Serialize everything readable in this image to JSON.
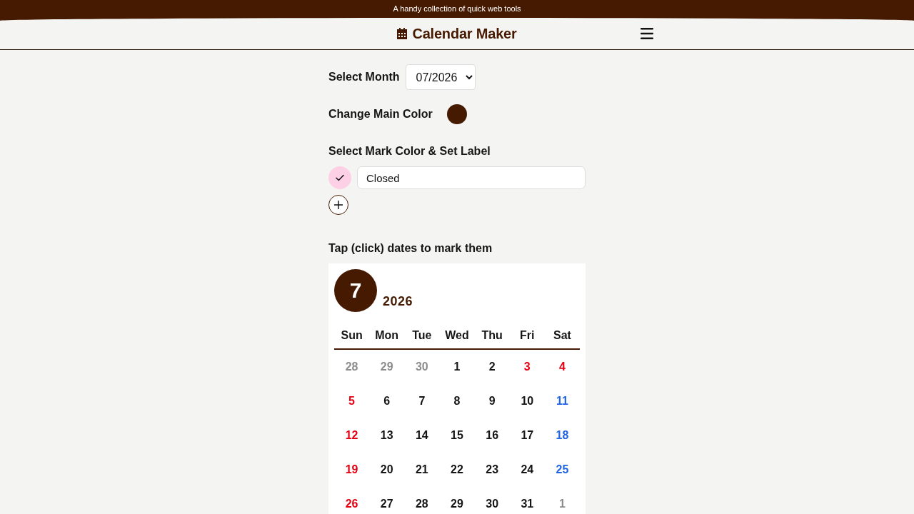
{
  "banner": {
    "text": "A handy collection of quick web tools"
  },
  "header": {
    "title": "Calendar Maker"
  },
  "month_select": {
    "label": "Select Month",
    "value": "07/2026"
  },
  "main_color": {
    "label": "Change Main Color",
    "color": "#461a00"
  },
  "marks_section": {
    "heading": "Select Mark Color & Set Label",
    "marks": [
      {
        "color": "#fdd0e6",
        "selected": true,
        "label": "Closed"
      }
    ]
  },
  "calendar": {
    "instruction": "Tap (click) dates to mark them",
    "month": "7",
    "year": "2026",
    "weekdays": [
      "Sun",
      "Mon",
      "Tue",
      "Wed",
      "Thu",
      "Fri",
      "Sat"
    ],
    "weeks": [
      [
        {
          "day": "28",
          "kind": "outside"
        },
        {
          "day": "29",
          "kind": "outside"
        },
        {
          "day": "30",
          "kind": "outside"
        },
        {
          "day": "1",
          "kind": "plain"
        },
        {
          "day": "2",
          "kind": "plain"
        },
        {
          "day": "3",
          "kind": "holiday"
        },
        {
          "day": "4",
          "kind": "holiday"
        }
      ],
      [
        {
          "day": "5",
          "kind": "holiday"
        },
        {
          "day": "6",
          "kind": "plain"
        },
        {
          "day": "7",
          "kind": "plain"
        },
        {
          "day": "8",
          "kind": "plain"
        },
        {
          "day": "9",
          "kind": "plain"
        },
        {
          "day": "10",
          "kind": "plain"
        },
        {
          "day": "11",
          "kind": "saturday"
        }
      ],
      [
        {
          "day": "12",
          "kind": "holiday"
        },
        {
          "day": "13",
          "kind": "plain"
        },
        {
          "day": "14",
          "kind": "plain"
        },
        {
          "day": "15",
          "kind": "plain"
        },
        {
          "day": "16",
          "kind": "plain"
        },
        {
          "day": "17",
          "kind": "plain"
        },
        {
          "day": "18",
          "kind": "saturday"
        }
      ],
      [
        {
          "day": "19",
          "kind": "holiday"
        },
        {
          "day": "20",
          "kind": "plain"
        },
        {
          "day": "21",
          "kind": "plain"
        },
        {
          "day": "22",
          "kind": "plain"
        },
        {
          "day": "23",
          "kind": "plain"
        },
        {
          "day": "24",
          "kind": "plain"
        },
        {
          "day": "25",
          "kind": "saturday"
        }
      ],
      [
        {
          "day": "26",
          "kind": "holiday"
        },
        {
          "day": "27",
          "kind": "plain"
        },
        {
          "day": "28",
          "kind": "plain"
        },
        {
          "day": "29",
          "kind": "plain"
        },
        {
          "day": "30",
          "kind": "plain"
        },
        {
          "day": "31",
          "kind": "plain"
        },
        {
          "day": "1",
          "kind": "outside"
        }
      ]
    ]
  }
}
